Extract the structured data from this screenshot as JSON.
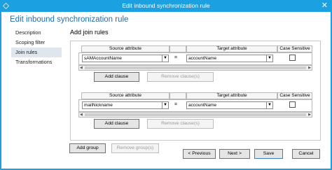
{
  "window": {
    "title": "Edit inbound synchronization rule",
    "close_glyph": "✕"
  },
  "page": {
    "heading": "Edit inbound synchronization rule",
    "section_title": "Add join rules"
  },
  "nav": {
    "items": [
      "Description",
      "Scoping filter",
      "Join rules",
      "Transformations"
    ],
    "active_index": 2
  },
  "columns": {
    "source": "Source attribute",
    "target": "Target attribute",
    "case": "Case Sensitive"
  },
  "rules": [
    {
      "source_value": "sAMAccountName",
      "operator": "=",
      "target_value": "accountName",
      "case_sensitive": false
    },
    {
      "source_value": "mailNickname",
      "operator": "=",
      "target_value": "accountName",
      "case_sensitive": false
    }
  ],
  "buttons": {
    "add_clause": "Add clause",
    "remove_clauses": "Remove clause(s)",
    "add_group": "Add group",
    "remove_groups": "Remove group(s)",
    "previous": "< Previous",
    "next": "Next >",
    "save": "Save",
    "cancel": "Cancel"
  },
  "icons": {
    "dropdown": "chevron-down-icon",
    "scroll_left": "arrow-left-icon",
    "scroll_right": "arrow-right-icon",
    "app": "diamond-icon"
  },
  "colors": {
    "accent": "#1ba1e2",
    "heading": "#1f6fb2",
    "nav_active": "#dfe6ee"
  }
}
